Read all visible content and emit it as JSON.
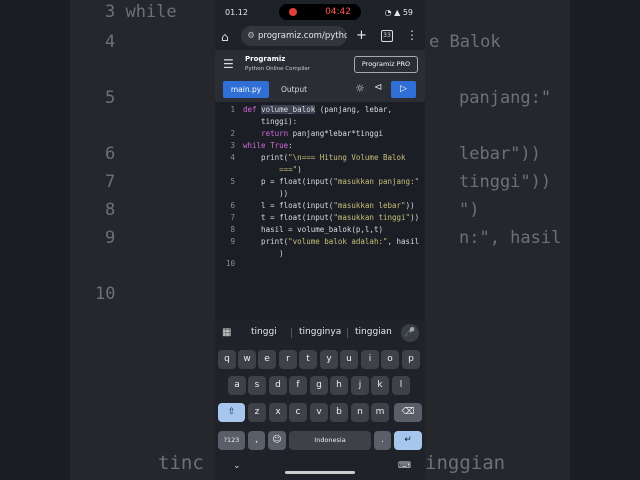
{
  "background": {
    "left_lines": [
      "3 while",
      "4",
      "5",
      "6",
      "7",
      "8",
      "9",
      "10"
    ],
    "right_lines": [
      "e Balok",
      "panjang:\"",
      "lebar\"))",
      "tinggi\"))",
      "\")",
      "n:\", hasil"
    ],
    "bottom_left": "tinc",
    "bottom_right": "inggian"
  },
  "status_bar": {
    "time": "01.12",
    "recording_time": "04:42",
    "battery": "59"
  },
  "browser": {
    "url": "programiz.com/pytho",
    "tab_count": "33"
  },
  "site": {
    "brand": "Programiz",
    "subtitle": "Python Online Compiler",
    "pro_button": "Programiz PRO"
  },
  "toolbar": {
    "tab_main": "main.py",
    "tab_output": "Output"
  },
  "editor": {
    "lines": [
      {
        "n": "1",
        "text": "def volume_balok (panjang, lebar,"
      },
      {
        "n": "",
        "text": "    tinggi):"
      },
      {
        "n": "2",
        "text": "    return panjang*lebar*tinggi"
      },
      {
        "n": "3",
        "text": "while True:"
      },
      {
        "n": "4",
        "text": "    print(\"\\n=== Hitung Volume Balok"
      },
      {
        "n": "",
        "text": "        ===\")"
      },
      {
        "n": "5",
        "text": "    p = float(input(\"masukkan panjang:\""
      },
      {
        "n": "",
        "text": "        ))"
      },
      {
        "n": "6",
        "text": "    l = float(input(\"masukkan lebar\"))"
      },
      {
        "n": "7",
        "text": "    t = float(input(\"masukkan tinggi\"))"
      },
      {
        "n": "8",
        "text": "    hasil = volume_balok(p,l,t)"
      },
      {
        "n": "9",
        "text": "    print(\"volume balok adalah:\", hasil"
      },
      {
        "n": "",
        "text": "        )"
      },
      {
        "n": "",
        "text": ""
      },
      {
        "n": "10",
        "text": ""
      }
    ]
  },
  "suggestions": [
    "tinggi",
    "tingginya",
    "tinggian"
  ],
  "keyboard": {
    "row1": [
      "q",
      "w",
      "e",
      "r",
      "t",
      "y",
      "u",
      "i",
      "o",
      "p"
    ],
    "row1_hints": [
      "1",
      "2",
      "3",
      "4",
      "5",
      "6",
      "7",
      "8",
      "9",
      "0"
    ],
    "row2": [
      "a",
      "s",
      "d",
      "f",
      "g",
      "h",
      "j",
      "k",
      "l"
    ],
    "row3": [
      "z",
      "x",
      "c",
      "v",
      "b",
      "n",
      "m"
    ],
    "sym_key": "?123",
    "comma": ",",
    "space": "Indonesia",
    "period": "."
  }
}
